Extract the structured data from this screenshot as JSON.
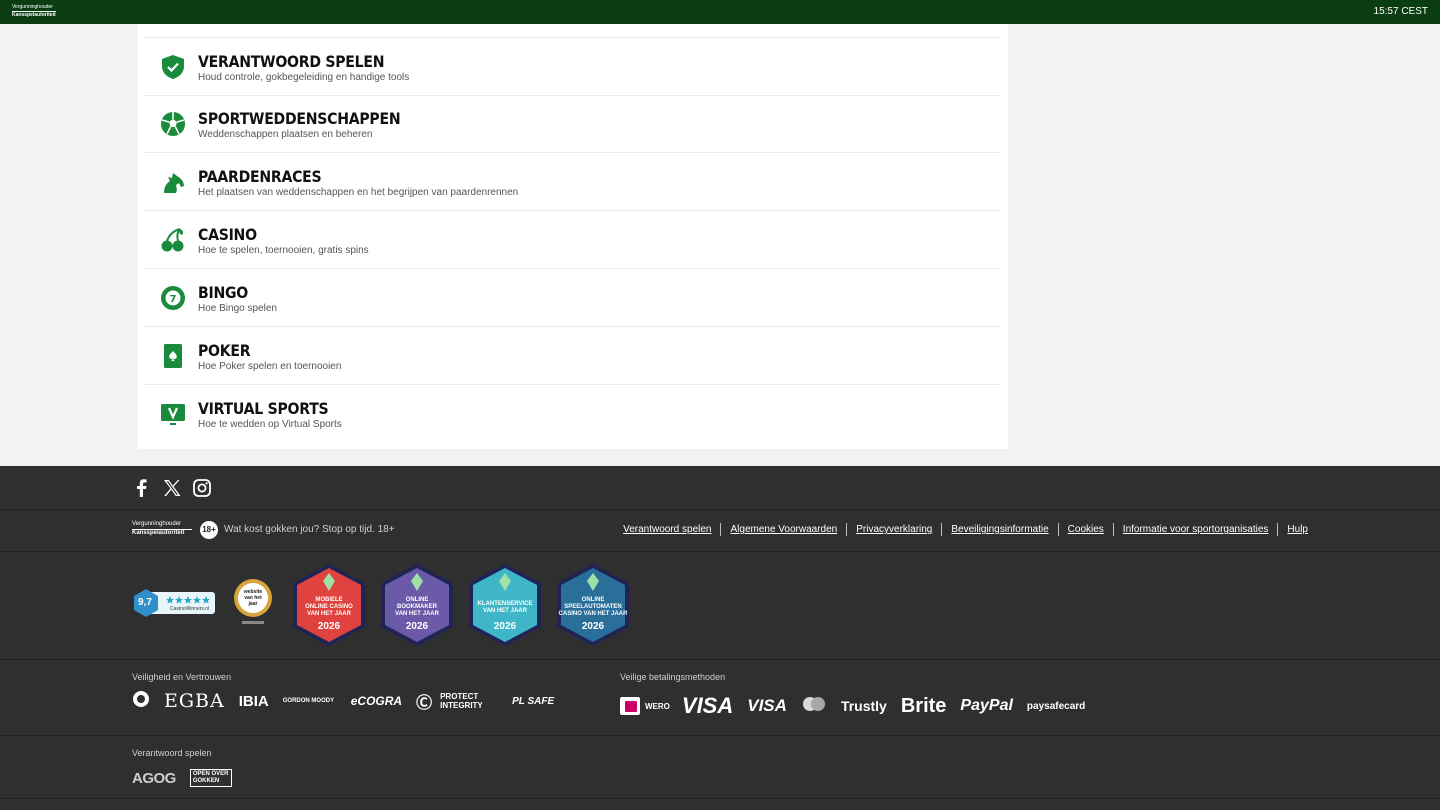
{
  "topbar": {
    "regulator_line1": "Vergunninghouder",
    "regulator_line2": "Kansspelautoriteit",
    "time": "15:57 CEST"
  },
  "help_items": [
    {
      "title": "VERANTWOORD SPELEN",
      "subtitle": "Houd controle, gokbegeleiding en handige tools",
      "icon": "shield-check-icon"
    },
    {
      "title": "SPORTWEDDENSCHAPPEN",
      "subtitle": "Weddenschappen plaatsen en beheren",
      "icon": "football-icon"
    },
    {
      "title": "PAARDENRACES",
      "subtitle": "Het plaatsen van weddenschappen en het begrijpen van paardenrennen",
      "icon": "horse-icon"
    },
    {
      "title": "CASINO",
      "subtitle": "Hoe te spelen, toernooien, gratis spins",
      "icon": "cherries-icon"
    },
    {
      "title": "BINGO",
      "subtitle": "Hoe Bingo spelen",
      "icon": "bingo-ball-icon"
    },
    {
      "title": "POKER",
      "subtitle": "Hoe Poker spelen en toernooien",
      "icon": "playing-card-icon"
    },
    {
      "title": "VIRTUAL SPORTS",
      "subtitle": "Hoe te wedden op Virtual Sports",
      "icon": "virtual-screen-icon"
    }
  ],
  "footer": {
    "social": [
      "facebook-icon",
      "x-icon",
      "instagram-icon"
    ],
    "regulator_line1": "Vergunninghouder",
    "regulator_line2": "Kansspelautoriteit",
    "age_badge": "18+",
    "age_message": "Wat kost gokken jou? Stop op tijd. 18+",
    "links": [
      "Verantwoord spelen",
      "Algemene Voorwaarden",
      "Privacyverklaring",
      "Beveiligingsinformatie",
      "Cookies",
      "Informatie voor sportorganisaties",
      "Hulp"
    ],
    "rating": {
      "score": "9,7",
      "site": "CasinoWinners.nl"
    },
    "website_award": "website van het jaar",
    "awards": [
      {
        "lines": [
          "MOBIELE",
          "ONLINE CASINO",
          "VAN HET JAAR"
        ],
        "year": "2026",
        "color": "#e0433f"
      },
      {
        "lines": [
          "ONLINE",
          "BOOKMAKER",
          "VAN HET JAAR"
        ],
        "year": "2026",
        "color": "#6a5aa8"
      },
      {
        "lines": [
          "KLANTENSERVICE",
          "VAN HET JAAR"
        ],
        "year": "2026",
        "color": "#3fb6c7"
      },
      {
        "lines": [
          "ONLINE",
          "SPEELAUTOMATEN",
          "CASINO VAN HET JAAR"
        ],
        "year": "2026",
        "color": "#2a6f9a"
      }
    ],
    "trust_label": "Veiligheid en Vertrouwen",
    "trust_logos": [
      "EGBA",
      "IBIA",
      "GORDON MOODY",
      "eCOGRA",
      "PROTECT INTEGRITY",
      "PL SAFE"
    ],
    "payment_label": "Veilige betalingsmethoden",
    "payment_logos": [
      "WERO",
      "VISA",
      "VISA",
      "Trustly",
      "Brite",
      "PayPal",
      "paysafecard"
    ],
    "responsible_label": "Verantwoord spelen",
    "responsible_logos": [
      "AGOG",
      "OPEN OVER GOKKEN"
    ]
  }
}
